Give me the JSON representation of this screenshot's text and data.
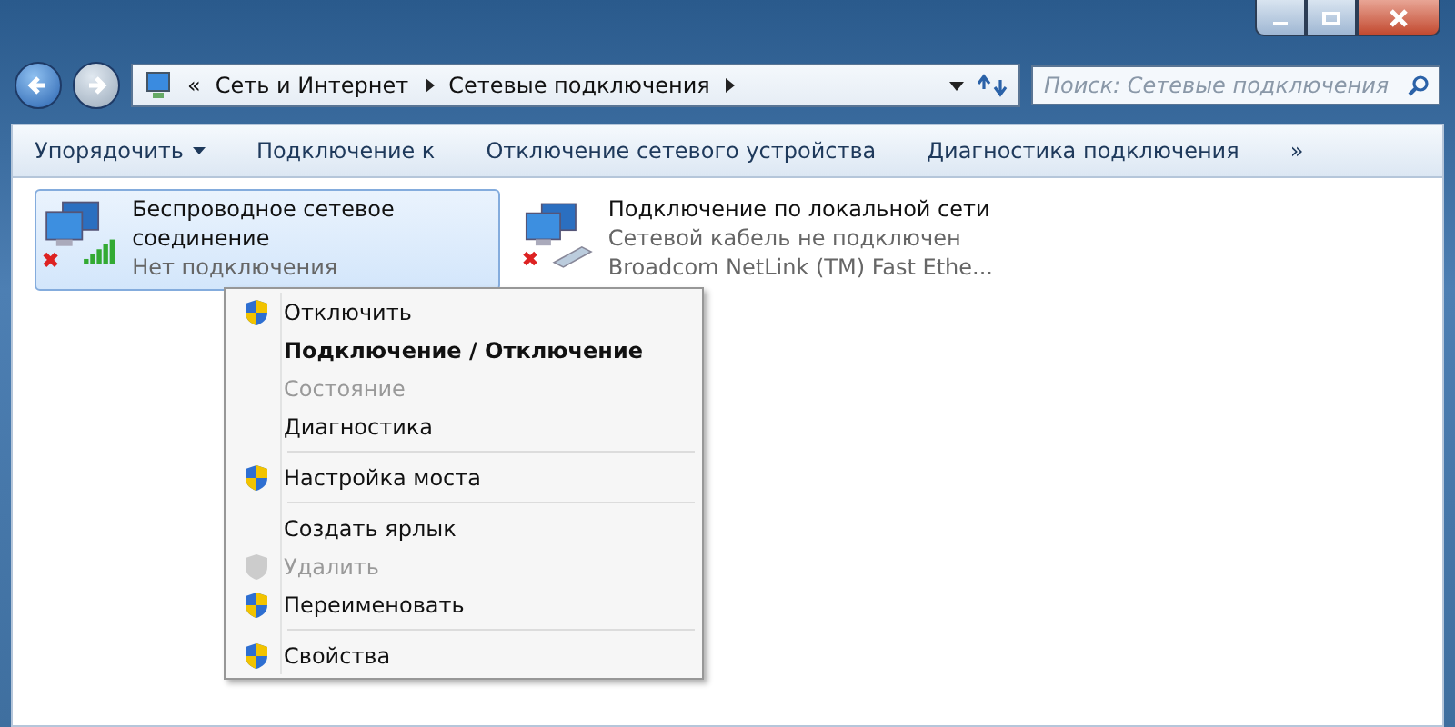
{
  "address_bar": {
    "prefix": "«",
    "crumbs": [
      "Сеть и Интернет",
      "Сетевые подключения"
    ]
  },
  "search": {
    "placeholder": "Поиск: Сетевые подключения"
  },
  "toolbar": {
    "items": [
      {
        "label": "Упорядочить",
        "dropdown": true
      },
      {
        "label": "Подключение к",
        "dropdown": false
      },
      {
        "label": "Отключение сетевого устройства",
        "dropdown": false
      },
      {
        "label": "Диагностика подключения",
        "dropdown": false
      }
    ],
    "overflow": "»"
  },
  "connections": [
    {
      "name": "Беспроводное сетевое соединение",
      "status": "Нет подключения",
      "kind": "wireless",
      "selected": true
    },
    {
      "name": "Подключение по локальной сети",
      "status": "Сетевой кабель не подключен",
      "device": "Broadcom NetLink (TM) Fast Ethe...",
      "kind": "wired",
      "selected": false
    }
  ],
  "context_menu": {
    "groups": [
      [
        {
          "label": "Отключить",
          "shield": true,
          "bold": false,
          "disabled": false
        },
        {
          "label": "Подключение / Отключение",
          "shield": false,
          "bold": true,
          "disabled": false
        },
        {
          "label": "Состояние",
          "shield": false,
          "bold": false,
          "disabled": true
        },
        {
          "label": "Диагностика",
          "shield": false,
          "bold": false,
          "disabled": false
        }
      ],
      [
        {
          "label": "Настройка моста",
          "shield": true,
          "bold": false,
          "disabled": false
        }
      ],
      [
        {
          "label": "Создать ярлык",
          "shield": false,
          "bold": false,
          "disabled": false
        },
        {
          "label": "Удалить",
          "shield": true,
          "bold": false,
          "disabled": true
        },
        {
          "label": "Переименовать",
          "shield": true,
          "bold": false,
          "disabled": false
        }
      ],
      [
        {
          "label": "Свойства",
          "shield": true,
          "bold": false,
          "disabled": false
        }
      ]
    ]
  }
}
